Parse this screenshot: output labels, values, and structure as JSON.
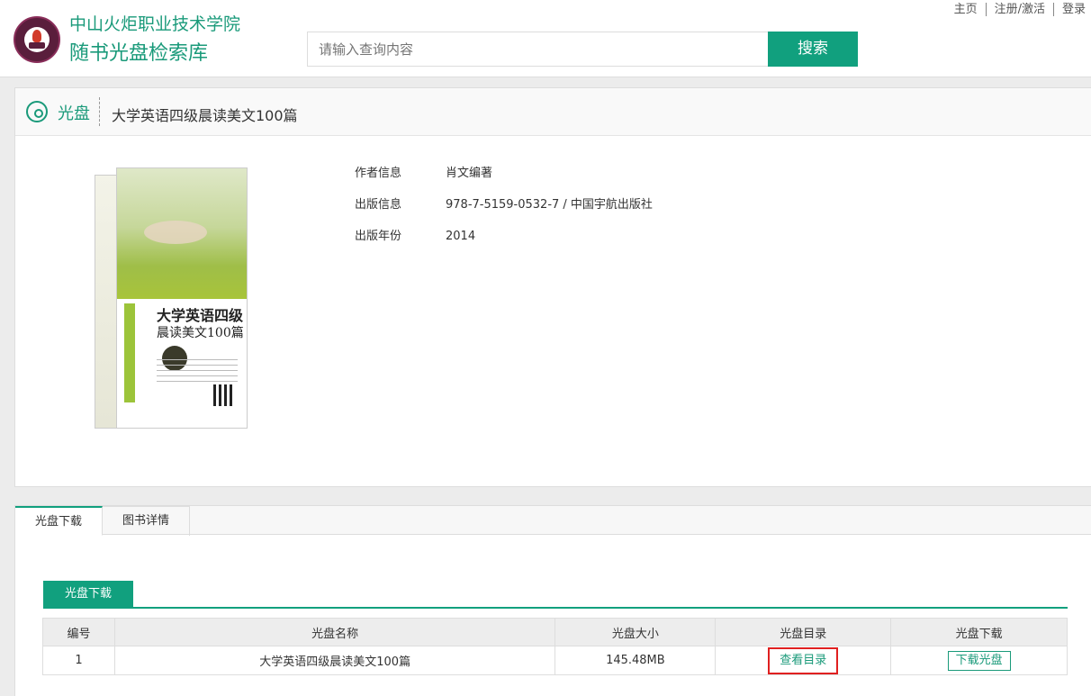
{
  "header": {
    "site_name": "中山火炬职业技术学院",
    "site_subtitle": "随书光盘检索库",
    "search_placeholder": "请输入查询内容",
    "search_button": "搜索",
    "links": [
      "主页",
      "注册/激活",
      "登录"
    ]
  },
  "detail": {
    "tag": "光盘",
    "title": "大学英语四级晨读美文100篇",
    "cover": {
      "title": "大学英语四级",
      "subtitle": "晨读美文100篇"
    },
    "info": [
      {
        "label": "作者信息",
        "value": "肖文编著"
      },
      {
        "label": "出版信息",
        "value": "978-7-5159-0532-7 / 中国宇航出版社"
      },
      {
        "label": "出版年份",
        "value": "2014"
      }
    ]
  },
  "tabs": [
    "光盘下载",
    "图书详情"
  ],
  "download": {
    "section_label": "光盘下载",
    "columns": [
      "编号",
      "光盘名称",
      "光盘大小",
      "光盘目录",
      "光盘下载"
    ],
    "rows": [
      {
        "no": "1",
        "name": "大学英语四级晨读美文100篇",
        "size": "145.48MB",
        "catalog_btn": "查看目录",
        "download_btn": "下载光盘"
      }
    ]
  },
  "colors": {
    "accent": "#11a07e",
    "highlight": "#e02020"
  }
}
